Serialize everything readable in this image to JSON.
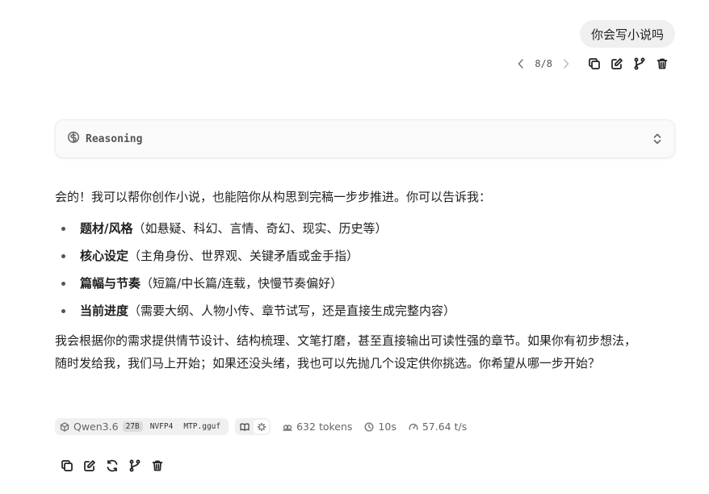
{
  "user_message": {
    "text": "你会写小说吗"
  },
  "pager": {
    "count": "8/8"
  },
  "reasoning": {
    "label": "Reasoning"
  },
  "answer": {
    "intro": "会的！我可以帮你创作小说，也能陪你从构思到完稿一步步推进。你可以告诉我：",
    "items": [
      {
        "term": "题材/风格",
        "desc": "（如悬疑、科幻、言情、奇幻、现实、历史等）"
      },
      {
        "term": "核心设定",
        "desc": "（主角身份、世界观、关键矛盾或金手指）"
      },
      {
        "term": "篇幅与节奏",
        "desc": "（短篇/中长篇/连载，快慢节奏偏好）"
      },
      {
        "term": "当前进度",
        "desc": "（需要大纲、人物小传、章节试写，还是直接生成完整内容）"
      }
    ],
    "outro_line1": "我会根据你的需求提供情节设计、结构梳理、文笔打磨，甚至直接输出可读性强的章节。如果你有初步想法，",
    "outro_line2": "随时发给我，我们马上开始；如果还没头绪，我也可以先抛几个设定供你挑选。你希望从哪一步开始？"
  },
  "stats": {
    "model_name": "Qwen3.6",
    "tags": [
      "27B",
      "NVFP4",
      "MTP.gguf"
    ],
    "tokens": "632 tokens",
    "time": "10s",
    "speed": "57.64 t/s"
  },
  "icons": {
    "prev": "chevron-left-icon",
    "next": "chevron-right-icon",
    "copy": "copy-icon",
    "edit": "edit-icon",
    "branch": "branch-icon",
    "delete": "trash-icon",
    "regenerate": "refresh-icon",
    "reasoning": "brain-icon",
    "expand": "chevron-up-down-icon"
  }
}
